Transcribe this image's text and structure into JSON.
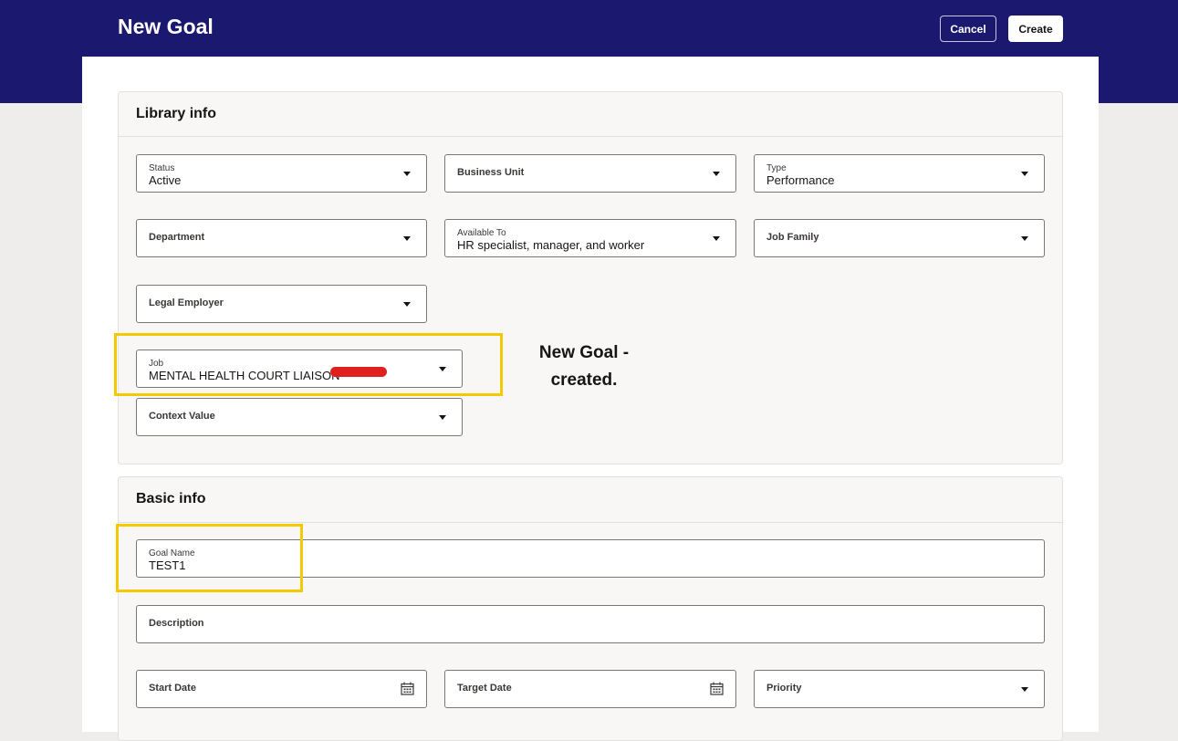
{
  "header": {
    "title": "New Goal",
    "cancel_label": "Cancel",
    "create_label": "Create",
    "band_color": "#1b1870"
  },
  "library_info": {
    "title": "Library info",
    "status": {
      "label": "Status",
      "value": "Active"
    },
    "business_unit": {
      "placeholder": "Business Unit"
    },
    "type": {
      "label": "Type",
      "value": "Performance"
    },
    "department": {
      "placeholder": "Department"
    },
    "available_to": {
      "label": "Available To",
      "value": "HR specialist, manager, and worker"
    },
    "job_family": {
      "placeholder": "Job Family"
    },
    "legal_employer": {
      "placeholder": "Legal Employer"
    },
    "job": {
      "label": "Job",
      "value": "MENTAL HEALTH COURT LIAISON"
    },
    "context_value": {
      "placeholder": "Context Value"
    }
  },
  "annotation": {
    "line1": "New Goal -",
    "line2": "created.",
    "highlight_color": "#f5c900",
    "redaction_color": "#e0201d"
  },
  "basic_info": {
    "title": "Basic info",
    "goal_name": {
      "label": "Goal Name",
      "value": "TEST1"
    },
    "description": {
      "placeholder": "Description"
    },
    "start_date": {
      "placeholder": "Start Date",
      "icon": "calendar-icon"
    },
    "target_date": {
      "placeholder": "Target Date",
      "icon": "calendar-icon"
    },
    "priority": {
      "placeholder": "Priority"
    }
  }
}
